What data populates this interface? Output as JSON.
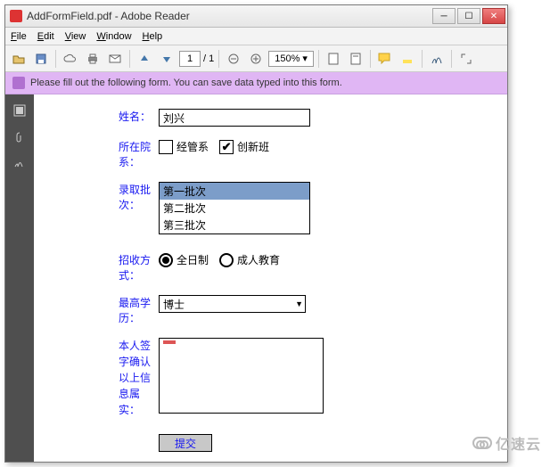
{
  "titlebar": {
    "title": "AddFormField.pdf - Adobe Reader"
  },
  "menubar": {
    "items": [
      "File",
      "Edit",
      "View",
      "Window",
      "Help"
    ]
  },
  "toolbar": {
    "page_current": "1",
    "page_total": "/ 1",
    "zoom": "150%"
  },
  "notice": {
    "text": "Please fill out the following form. You can save data typed into this form."
  },
  "form": {
    "name_label": "姓名：",
    "name_value": "刘兴",
    "dept_label": "所在院系：",
    "dept_cb1": "经管系",
    "dept_cb1_checked": false,
    "dept_cb2": "创新班",
    "dept_cb2_checked": true,
    "batch_label": "录取批次：",
    "batch_opts": [
      "第一批次",
      "第二批次",
      "第三批次"
    ],
    "batch_selected": 0,
    "mode_label": "招收方式：",
    "mode_r1": "全日制",
    "mode_r2": "成人教育",
    "mode_selected": 0,
    "edu_label": "最高学历：",
    "edu_value": "博士",
    "confirm_label1": "本人签字确认",
    "confirm_label2": "以上信息属实：",
    "submit": "提交"
  },
  "watermark": "亿速云"
}
